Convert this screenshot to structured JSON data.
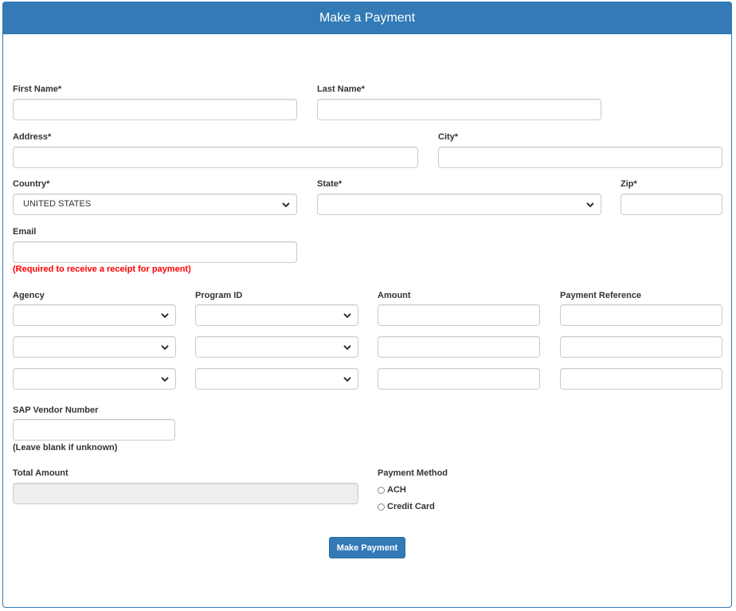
{
  "header": {
    "title": "Make a Payment"
  },
  "form": {
    "first_name": {
      "label": "First Name*",
      "value": ""
    },
    "last_name": {
      "label": "Last Name*",
      "value": ""
    },
    "address": {
      "label": "Address*",
      "value": ""
    },
    "city": {
      "label": "City*",
      "value": ""
    },
    "country": {
      "label": "Country*",
      "selected": "UNITED STATES"
    },
    "state": {
      "label": "State*",
      "selected": ""
    },
    "zip": {
      "label": "Zip*",
      "value": ""
    },
    "email": {
      "label": "Email",
      "value": "",
      "help": "(Required to receive a receipt for payment)"
    },
    "line_items": {
      "headers": {
        "agency": "Agency",
        "program_id": "Program ID",
        "amount": "Amount",
        "payment_reference": "Payment Reference"
      },
      "rows": [
        {
          "agency": "",
          "program_id": "",
          "amount": "",
          "payment_reference": ""
        },
        {
          "agency": "",
          "program_id": "",
          "amount": "",
          "payment_reference": ""
        },
        {
          "agency": "",
          "program_id": "",
          "amount": "",
          "payment_reference": ""
        }
      ]
    },
    "sap_vendor": {
      "label": "SAP Vendor Number",
      "value": "",
      "help": "(Leave blank if unknown)"
    },
    "total_amount": {
      "label": "Total Amount",
      "value": ""
    },
    "payment_method": {
      "label": "Payment Method",
      "options": [
        {
          "label": "ACH",
          "selected": false
        },
        {
          "label": "Credit Card",
          "selected": false
        }
      ]
    },
    "submit_label": "Make Payment"
  },
  "colors": {
    "primary": "#337ab7",
    "error": "#ff0000",
    "disabled_bg": "#eeeeee"
  }
}
